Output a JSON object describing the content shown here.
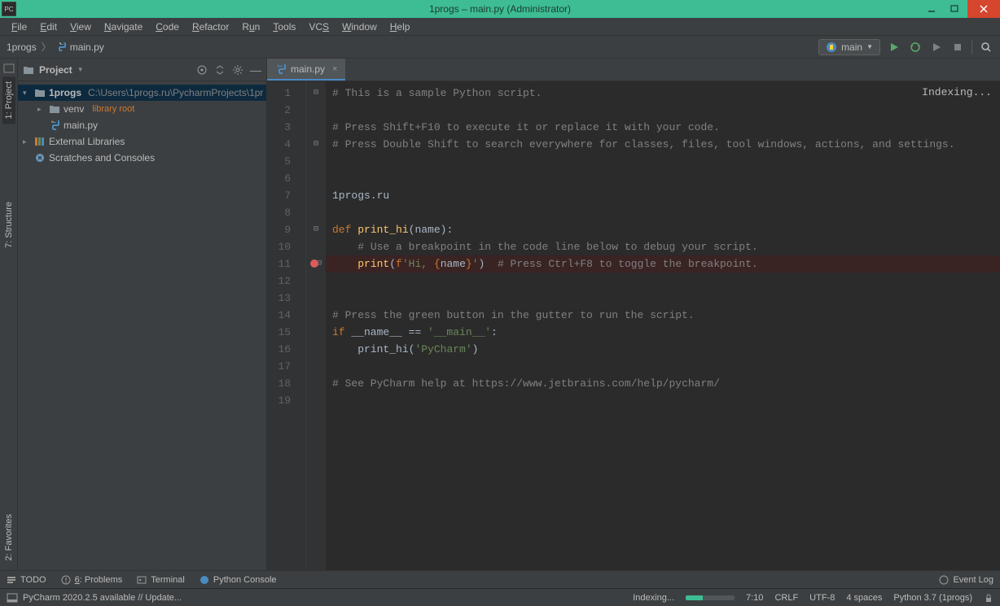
{
  "window": {
    "title": "1progs – main.py (Administrator)",
    "icon": "PC"
  },
  "menus": [
    "File",
    "Edit",
    "View",
    "Navigate",
    "Code",
    "Refactor",
    "Run",
    "Tools",
    "VCS",
    "Window",
    "Help"
  ],
  "breadcrumbs": {
    "root": "1progs",
    "file": "main.py"
  },
  "run_config": {
    "label": "main"
  },
  "panel": {
    "title": "Project"
  },
  "tree": {
    "root": {
      "name": "1progs",
      "path": "C:\\Users\\1progs.ru\\PycharmProjects\\1pr"
    },
    "venv": {
      "name": "venv",
      "hint": "library root"
    },
    "file": "main.py",
    "ext": "External Libraries",
    "scratch": "Scratches and Consoles"
  },
  "left_tabs": [
    "1: Project",
    "7: Structure",
    "2: Favorites"
  ],
  "editor_tab": "main.py",
  "indexing": "Indexing...",
  "code": {
    "lines": [
      "# This is a sample Python script.",
      "",
      "# Press Shift+F10 to execute it or replace it with your code.",
      "# Press Double Shift to search everywhere for classes, files, tool windows, actions, and settings.",
      "",
      "",
      "1progs.ru",
      "",
      "def print_hi(name):",
      "    # Use a breakpoint in the code line below to debug your script.",
      "    print(f'Hi, {name}')  # Press Ctrl+F8 to toggle the breakpoint.",
      "",
      "",
      "# Press the green button in the gutter to run the script.",
      "if __name__ == '__main__':",
      "    print_hi('PyCharm')",
      "",
      "# See PyCharm help at https://www.jetbrains.com/help/pycharm/",
      ""
    ],
    "breakpoint_line": 11
  },
  "bottom": {
    "todo": "TODO",
    "problems": "6: Problems",
    "terminal": "Terminal",
    "console": "Python Console",
    "eventlog": "Event Log"
  },
  "status": {
    "update": "PyCharm 2020.2.5 available // Update...",
    "indexing": "Indexing...",
    "cursor": "7:10",
    "eol": "CRLF",
    "encoding": "UTF-8",
    "indent": "4 spaces",
    "interpreter": "Python 3.7 (1progs)"
  }
}
